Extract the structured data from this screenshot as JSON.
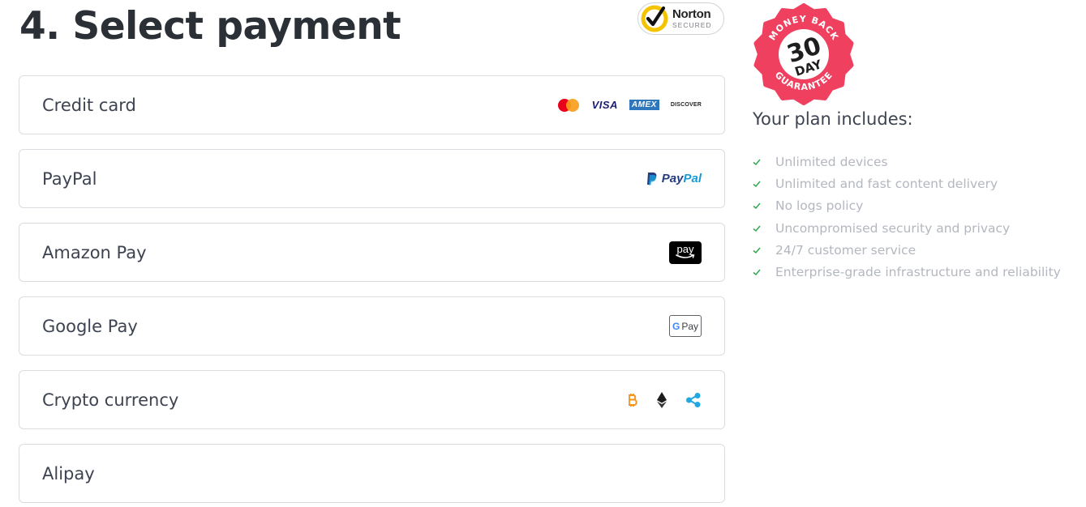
{
  "page": {
    "heading": "4. Select payment"
  },
  "norton": {
    "brand": "Norton",
    "secured": "SECURED"
  },
  "methods": [
    {
      "label": "Credit card",
      "logos": [
        "mastercard-icon",
        "visa-icon",
        "amex-icon",
        "discover-icon"
      ],
      "visa": "VISA",
      "amex": "AMEX",
      "discover": "DISCOVER"
    },
    {
      "label": "PayPal",
      "logos": [
        "paypal-icon"
      ],
      "pay": "Pay",
      "pal": "Pal"
    },
    {
      "label": "Amazon Pay",
      "logos": [
        "amazon-pay-icon"
      ],
      "mark": "pay"
    },
    {
      "label": "Google Pay",
      "logos": [
        "google-pay-icon"
      ],
      "g": "G",
      "pay": "Pay"
    },
    {
      "label": "Crypto currency",
      "logos": [
        "bitcoin-icon",
        "ethereum-icon",
        "ripple-icon"
      ]
    },
    {
      "label": "Alipay",
      "logos": []
    }
  ],
  "guarantee": {
    "top": "MONEY BACK",
    "number": "30",
    "unit": "DAY",
    "bottom": "GUARANTEE"
  },
  "plan": {
    "title": "Your plan includes:",
    "features": [
      "Unlimited devices",
      "Unlimited and fast content delivery",
      "No logs policy",
      "Uncompromised security and privacy",
      "24/7 customer service",
      "Enterprise-grade infrastructure and reliability"
    ]
  },
  "colors": {
    "seal": "#f0405f",
    "check": "#2fa84f",
    "heading": "#2b2f36"
  }
}
